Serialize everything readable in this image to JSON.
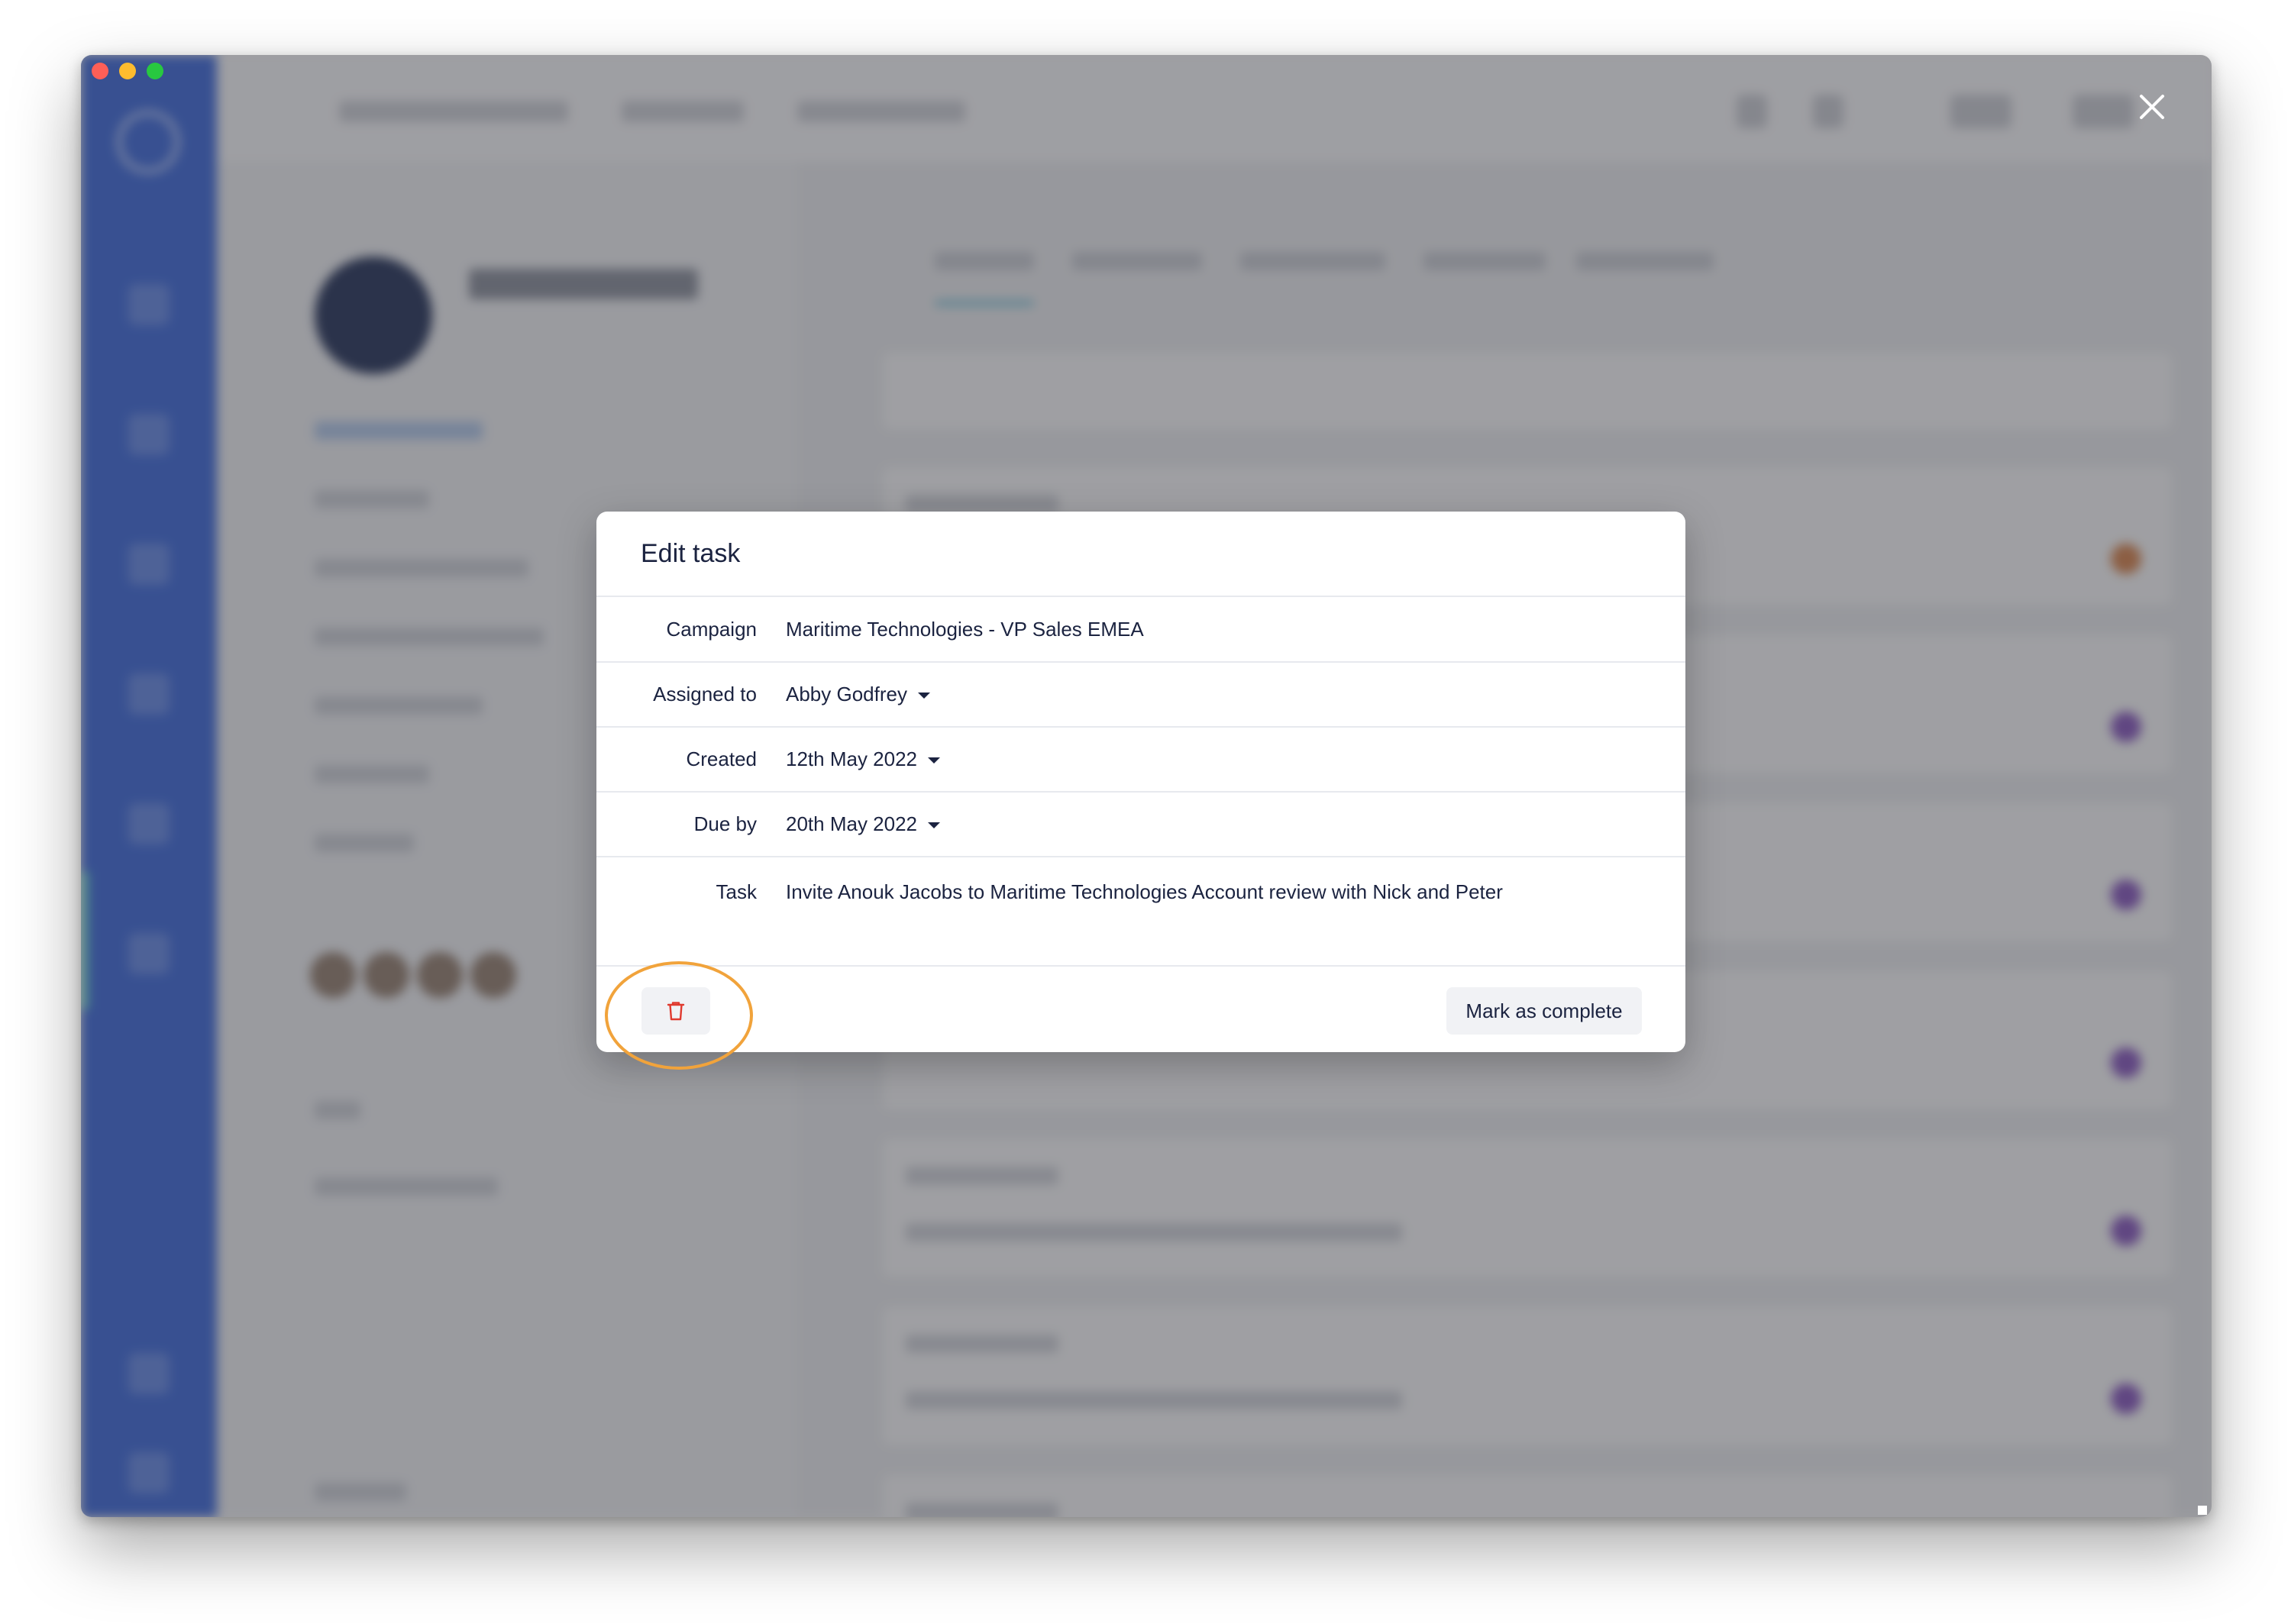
{
  "window": {
    "traffic_lights": [
      "close",
      "minimize",
      "zoom"
    ],
    "colors": {
      "red": "#fe5f57",
      "yellow": "#febc2e",
      "green": "#28c840"
    }
  },
  "background": {
    "blurred": true,
    "overlay": "dim"
  },
  "close_icon": "close-icon",
  "modal": {
    "title": "Edit task",
    "fields": {
      "campaign": {
        "label": "Campaign",
        "value": "Maritime Technologies - VP Sales EMEA"
      },
      "assigned_to": {
        "label": "Assigned to",
        "value": "Abby Godfrey"
      },
      "created": {
        "label": "Created",
        "value": "12th May 2022"
      },
      "due_by": {
        "label": "Due by",
        "value": "20th May 2022"
      },
      "task": {
        "label": "Task",
        "value": "Invite Anouk Jacobs to Maritime Technologies Account review with Nick and Peter"
      }
    },
    "footer": {
      "delete_icon": "trash-icon",
      "complete_label": "Mark as complete"
    }
  },
  "colors": {
    "accent_highlight": "#f1a33b",
    "danger": "#e03a2f",
    "text": "#1b2340",
    "sidebar": "#2a5bd7"
  }
}
